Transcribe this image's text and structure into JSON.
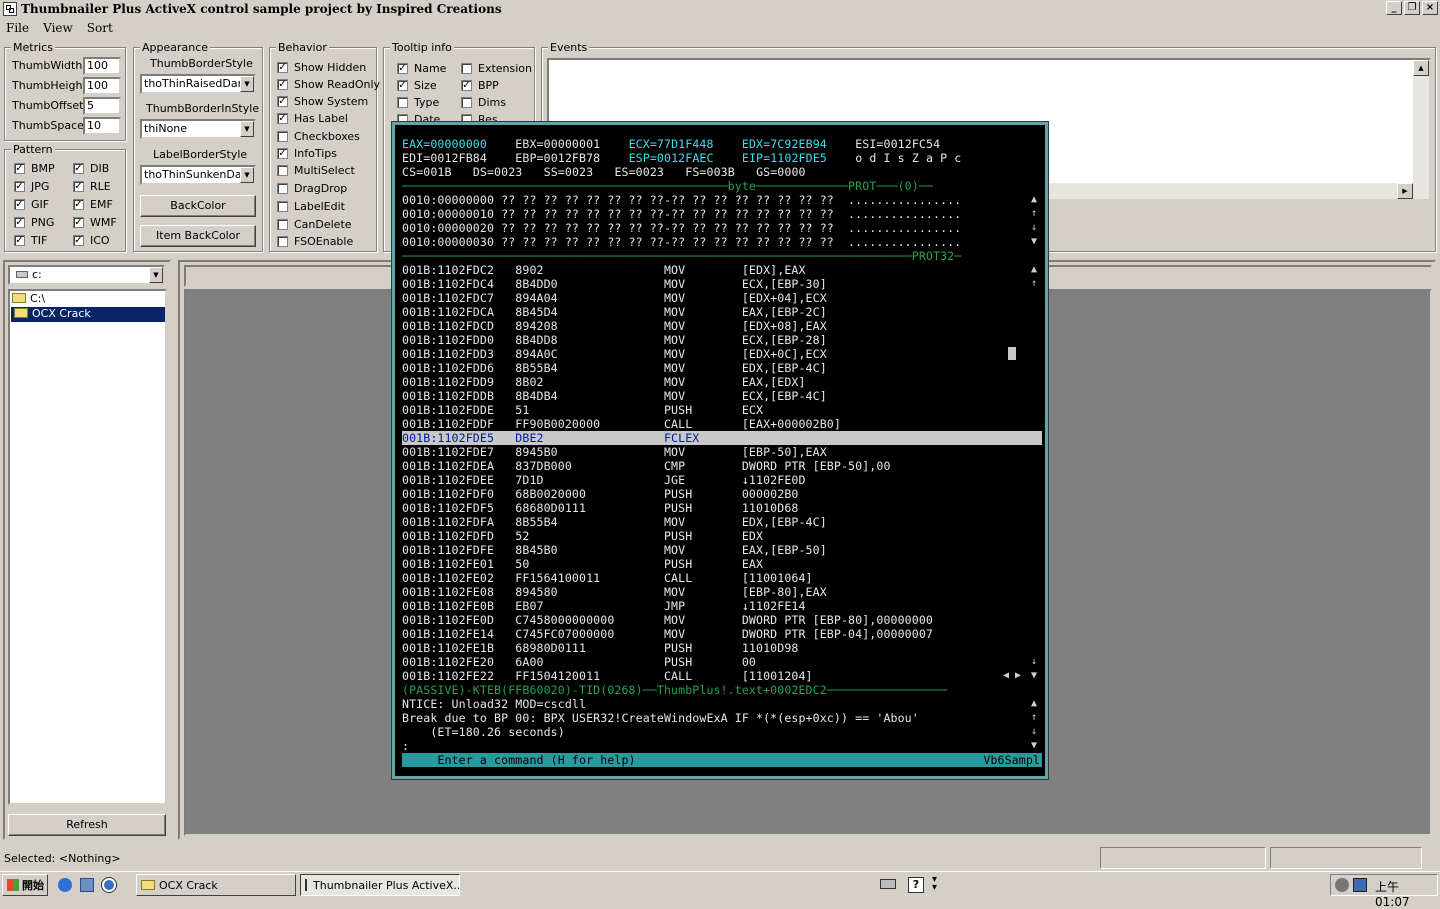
{
  "window": {
    "title": "Thumbnailer Plus ActiveX control sample project by Inspired Creations",
    "btn_min": "_",
    "btn_max": "❐",
    "btn_close": "×"
  },
  "menu": [
    "File",
    "View",
    "Sort"
  ],
  "metrics": {
    "title": "Metrics",
    "fields": [
      {
        "label": "ThumbWidth",
        "value": "100"
      },
      {
        "label": "ThumbHeight",
        "value": "100"
      },
      {
        "label": "ThumbOffset",
        "value": "5"
      },
      {
        "label": "ThumbSpace",
        "value": "10"
      }
    ]
  },
  "pattern": {
    "title": "Pattern",
    "items": [
      {
        "label": "BMP",
        "checked": true
      },
      {
        "label": "DIB",
        "checked": true
      },
      {
        "label": "JPG",
        "checked": true
      },
      {
        "label": "RLE",
        "checked": true
      },
      {
        "label": "GIF",
        "checked": true
      },
      {
        "label": "EMF",
        "checked": true
      },
      {
        "label": "PNG",
        "checked": true
      },
      {
        "label": "WMF",
        "checked": true
      },
      {
        "label": "TIF",
        "checked": true
      },
      {
        "label": "ICO",
        "checked": true
      }
    ]
  },
  "appearance": {
    "title": "Appearance",
    "border_style_label": "ThumbBorderStyle",
    "border_style_value": "thoThinRaisedDark",
    "border_in_style_label": "ThumbBorderInStyle",
    "border_in_style_value": "thiNone",
    "label_border_label": "LabelBorderStyle",
    "label_border_value": "thoThinSunkenDark",
    "backcolor_btn": "BackColor",
    "item_backcolor_btn": "Item BackColor"
  },
  "behavior": {
    "title": "Behavior",
    "items": [
      {
        "label": "Show Hidden",
        "checked": true
      },
      {
        "label": "Show ReadOnly",
        "checked": true
      },
      {
        "label": "Show System",
        "checked": true
      },
      {
        "label": "Has Label",
        "checked": true
      },
      {
        "label": "Checkboxes",
        "checked": false
      },
      {
        "label": "InfoTips",
        "checked": true
      },
      {
        "label": "MultiSelect",
        "checked": false
      },
      {
        "label": "DragDrop",
        "checked": false
      },
      {
        "label": "LabelEdit",
        "checked": false
      },
      {
        "label": "CanDelete",
        "checked": false
      },
      {
        "label": "FSOEnable",
        "checked": false
      }
    ]
  },
  "tooltip": {
    "title": "Tooltip info",
    "items": [
      {
        "label": "Name",
        "checked": true
      },
      {
        "label": "Extension",
        "checked": false
      },
      {
        "label": "Size",
        "checked": true
      },
      {
        "label": "BPP",
        "checked": true
      },
      {
        "label": "Type",
        "checked": false
      },
      {
        "label": "Dims",
        "checked": false
      },
      {
        "label": "Date",
        "checked": false
      },
      {
        "label": "Res",
        "checked": false
      }
    ]
  },
  "events": {
    "title": "Events"
  },
  "drive": {
    "value": "c:"
  },
  "tree": {
    "items": [
      "C:\\",
      "OCX Crack"
    ]
  },
  "refresh_btn": "Refresh",
  "debugger": {
    "regs": [
      [
        {
          "t": "EAX=00000000",
          "c": "cy"
        },
        {
          "t": "EBX=00000001",
          "c": "wt"
        },
        {
          "t": "ECX=77D1F448",
          "c": "cy"
        },
        {
          "t": "EDX=7C92EB94",
          "c": "cy"
        },
        {
          "t": "ESI=0012FC54",
          "c": "wt"
        }
      ],
      [
        {
          "t": "EDI=0012FB84",
          "c": "wt"
        },
        {
          "t": "EBP=0012FB78",
          "c": "wt"
        },
        {
          "t": "ESP=0012FAEC",
          "c": "cy"
        },
        {
          "t": "EIP=1102FDE5",
          "c": "cy"
        },
        {
          "t": "o d I s Z a P c",
          "c": "wt"
        }
      ],
      [
        {
          "t": "CS=001B",
          "c": "wt"
        },
        {
          "t": "DS=0023",
          "c": "wt"
        },
        {
          "t": "SS=0023",
          "c": "wt"
        },
        {
          "t": "ES=0023",
          "c": "wt"
        },
        {
          "t": "FS=003B",
          "c": "wt"
        },
        {
          "t": "GS=0000",
          "c": "wt"
        }
      ]
    ],
    "data_sep": "──────────────────────────────────────────────byte─────────────PROT───(0)──",
    "data_lines": [
      "0010:00000000 ?? ?? ?? ?? ?? ?? ?? ??-?? ?? ?? ?? ?? ?? ?? ??  ................",
      "0010:00000010 ?? ?? ?? ?? ?? ?? ?? ??-?? ?? ?? ?? ?? ?? ?? ??  ................",
      "0010:00000020 ?? ?? ?? ?? ?? ?? ?? ??-?? ?? ?? ?? ?? ?? ?? ??  ................",
      "0010:00000030 ?? ?? ?? ?? ?? ?? ?? ??-?? ?? ?? ?? ?? ?? ?? ??  ................"
    ],
    "code_sep": "────────────────────────────────────────────────────────────────────────PROT32─",
    "code_lines": [
      {
        "addr": "001B:1102FDC2",
        "bytes": "8902",
        "mn": "MOV",
        "op": "[EDX],EAX"
      },
      {
        "addr": "001B:1102FDC4",
        "bytes": "8B4DD0",
        "mn": "MOV",
        "op": "ECX,[EBP-30]"
      },
      {
        "addr": "001B:1102FDC7",
        "bytes": "894A04",
        "mn": "MOV",
        "op": "[EDX+04],ECX"
      },
      {
        "addr": "001B:1102FDCA",
        "bytes": "8B45D4",
        "mn": "MOV",
        "op": "EAX,[EBP-2C]"
      },
      {
        "addr": "001B:1102FDCD",
        "bytes": "894208",
        "mn": "MOV",
        "op": "[EDX+08],EAX"
      },
      {
        "addr": "001B:1102FDD0",
        "bytes": "8B4DD8",
        "mn": "MOV",
        "op": "ECX,[EBP-28]"
      },
      {
        "addr": "001B:1102FDD3",
        "bytes": "894A0C",
        "mn": "MOV",
        "op": "[EDX+0C],ECX"
      },
      {
        "addr": "001B:1102FDD6",
        "bytes": "8B55B4",
        "mn": "MOV",
        "op": "EDX,[EBP-4C]"
      },
      {
        "addr": "001B:1102FDD9",
        "bytes": "8B02",
        "mn": "MOV",
        "op": "EAX,[EDX]"
      },
      {
        "addr": "001B:1102FDDB",
        "bytes": "8B4DB4",
        "mn": "MOV",
        "op": "ECX,[EBP-4C]"
      },
      {
        "addr": "001B:1102FDDE",
        "bytes": "51",
        "mn": "PUSH",
        "op": "ECX"
      },
      {
        "addr": "001B:1102FDDF",
        "bytes": "FF90B0020000",
        "mn": "CALL",
        "op": "[EAX+000002B0]"
      },
      {
        "addr": "001B:1102FDE5",
        "bytes": "DBE2",
        "mn": "FCLEX",
        "op": "",
        "hl": true
      },
      {
        "addr": "001B:1102FDE7",
        "bytes": "8945B0",
        "mn": "MOV",
        "op": "[EBP-50],EAX"
      },
      {
        "addr": "001B:1102FDEA",
        "bytes": "837DB000",
        "mn": "CMP",
        "op": "DWORD PTR [EBP-50],00"
      },
      {
        "addr": "001B:1102FDEE",
        "bytes": "7D1D",
        "mn": "JGE",
        "op": "↓1102FE0D"
      },
      {
        "addr": "001B:1102FDF0",
        "bytes": "68B0020000",
        "mn": "PUSH",
        "op": "000002B0"
      },
      {
        "addr": "001B:1102FDF5",
        "bytes": "68680D0111",
        "mn": "PUSH",
        "op": "11010D68"
      },
      {
        "addr": "001B:1102FDFA",
        "bytes": "8B55B4",
        "mn": "MOV",
        "op": "EDX,[EBP-4C]"
      },
      {
        "addr": "001B:1102FDFD",
        "bytes": "52",
        "mn": "PUSH",
        "op": "EDX"
      },
      {
        "addr": "001B:1102FDFE",
        "bytes": "8B45B0",
        "mn": "MOV",
        "op": "EAX,[EBP-50]"
      },
      {
        "addr": "001B:1102FE01",
        "bytes": "50",
        "mn": "PUSH",
        "op": "EAX"
      },
      {
        "addr": "001B:1102FE02",
        "bytes": "FF1564100011",
        "mn": "CALL",
        "op": "[11001064]"
      },
      {
        "addr": "001B:1102FE08",
        "bytes": "894580",
        "mn": "MOV",
        "op": "[EBP-80],EAX"
      },
      {
        "addr": "001B:1102FE0B",
        "bytes": "EB07",
        "mn": "JMP",
        "op": "↓1102FE14"
      },
      {
        "addr": "001B:1102FE0D",
        "bytes": "C7458000000000",
        "mn": "MOV",
        "op": "DWORD PTR [EBP-80],00000000"
      },
      {
        "addr": "001B:1102FE14",
        "bytes": "C745FC07000000",
        "mn": "MOV",
        "op": "DWORD PTR [EBP-04],00000007"
      },
      {
        "addr": "001B:1102FE1B",
        "bytes": "68980D0111",
        "mn": "PUSH",
        "op": "11010D98"
      },
      {
        "addr": "001B:1102FE20",
        "bytes": "6A00",
        "mn": "PUSH",
        "op": "00"
      },
      {
        "addr": "001B:1102FE22",
        "bytes": "FF1504120011",
        "mn": "CALL",
        "op": "[11001204]"
      }
    ],
    "thread_line": "(PASSIVE)-KTEB(FFB60020)-TID(0268)──ThumbPlus!.text+0002EDC2─────────────────",
    "cmd_lines": [
      "NTICE: Unload32 MOD=cscdll",
      "Break due to BP 00: BPX USER32!CreateWindowExA IF *(*(esp+0xc)) == 'Abou'",
      "    (ET=180.26 seconds)",
      ":"
    ],
    "prompt": "     Enter a command (H for help)",
    "prompt_right": "Vb6Sampl"
  },
  "status": {
    "text": "Selected: <Nothing>"
  },
  "taskbar": {
    "start": "開始",
    "tasks": [
      "OCX Crack",
      "Thumbnailer Plus ActiveX..."
    ],
    "clock": "上午 01:07"
  },
  "colors": {
    "debug_cyan": "#37e0ee",
    "debug_green": "#27a14a",
    "selection": "#0a246a",
    "debug_frame": "#5fa5a9"
  }
}
